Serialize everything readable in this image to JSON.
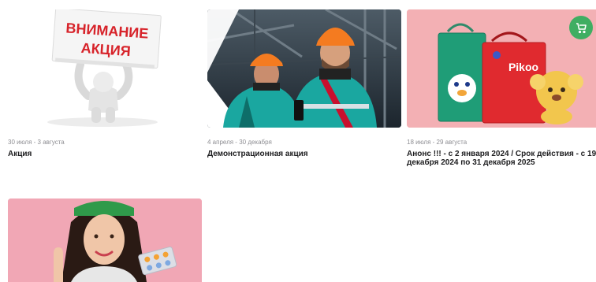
{
  "cards": [
    {
      "dates": "30 июля - 3 августа",
      "title": "Акция",
      "sign_line1": "ВНИМАНИЕ",
      "sign_line2": "АКЦИЯ"
    },
    {
      "dates": "4 апреля - 30 декабря",
      "title": "Демонстрационная акция"
    },
    {
      "dates": "18 июля - 29 августа",
      "title": "Анонс !!! - с 2 января 2024 / Срок действия - с 19 декабря 2024 по 31 декабря 2025",
      "brand_text": "Pikoo",
      "badge_icon": "stroller-icon"
    },
    {
      "dates": "",
      "title": ""
    }
  ],
  "colors": {
    "badge_green": "#3fae62",
    "card3_background": "#f3b0b4",
    "card4_background": "#f1a7b5",
    "sign_text": "#d7232a"
  }
}
